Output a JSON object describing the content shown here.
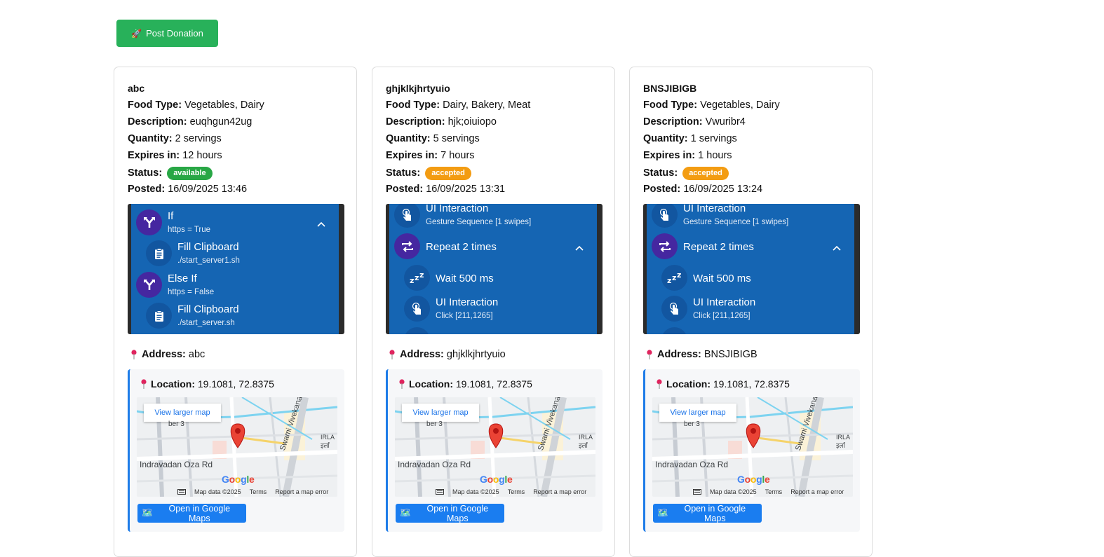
{
  "toolbar": {
    "post_label": "Post Donation",
    "post_icon": "rocket-icon"
  },
  "labels": {
    "food_type": "Food Type:",
    "description": "Description:",
    "quantity": "Quantity:",
    "expires": "Expires in:",
    "status": "Status:",
    "posted": "Posted:",
    "address": "Address:",
    "location": "Location:",
    "view_larger_map": "View larger map",
    "open_maps": "Open in Google Maps"
  },
  "map": {
    "road1": "Indravadan Oza Rd",
    "road2": "Swami Vivekananda",
    "road3": "IRLA",
    "road4": "इर्ला",
    "road5": "ber 3",
    "google": [
      "G",
      "o",
      "o",
      "g",
      "l",
      "e"
    ],
    "google_colors": [
      "#4285F4",
      "#EA4335",
      "#FBBC05",
      "#4285F4",
      "#34A853",
      "#EA4335"
    ],
    "footer": [
      "Map data ©2025",
      "Terms",
      "Report a map error"
    ]
  },
  "colors": {
    "available": "#28a745",
    "accepted": "#f39c12",
    "accent": "#1e7ce8"
  },
  "cards": [
    {
      "title": "abc",
      "food_type": "Vegetables, Dairy",
      "description": "euqhgun42ug",
      "quantity": "2 servings",
      "expires": "12 hours",
      "status": "available",
      "status_color": "#28a745",
      "posted": "16/09/2025 13:46",
      "address": "abc",
      "location": "19.1081, 72.8375",
      "macro": {
        "r1_title": "If",
        "r1_sub": "https = True",
        "r2_title": "Fill Clipboard",
        "r2_sub": "./start_server1.sh",
        "r3_title": "Else If",
        "r3_sub": "https = False",
        "r4_title": "Fill Clipboard",
        "r4_sub": "./start_server.sh"
      }
    },
    {
      "title": "ghjklkjhrtyuio",
      "food_type": "Dairy, Bakery, Meat",
      "description": "hjk;oiuiopo",
      "quantity": "5 servings",
      "expires": "7 hours",
      "status": "accepted",
      "status_color": "#f39c12",
      "posted": "16/09/2025 13:31",
      "address": "ghjklkjhrtyuio",
      "location": "19.1081, 72.8375",
      "macro": {
        "r1_title": "UI Interaction",
        "r1_sub": "Gesture Sequence [1 swipes]",
        "r2_title": "Repeat 2 times",
        "r3_title": "Wait 500 ms",
        "r4_title": "UI Interaction",
        "r4_sub": "Click [211,1265]"
      }
    },
    {
      "title": "BNSJIBIGB",
      "food_type": "Vegetables, Dairy",
      "description": "Vwuribr4",
      "quantity": "1 servings",
      "expires": "1 hours",
      "status": "accepted",
      "status_color": "#f39c12",
      "posted": "16/09/2025 13:24",
      "address": "BNSJIBIGB",
      "location": "19.1081, 72.8375",
      "macro": {
        "r1_title": "UI Interaction",
        "r1_sub": "Gesture Sequence [1 swipes]",
        "r2_title": "Repeat 2 times",
        "r3_title": "Wait 500 ms",
        "r4_title": "UI Interaction",
        "r4_sub": "Click [211,1265]"
      }
    }
  ]
}
